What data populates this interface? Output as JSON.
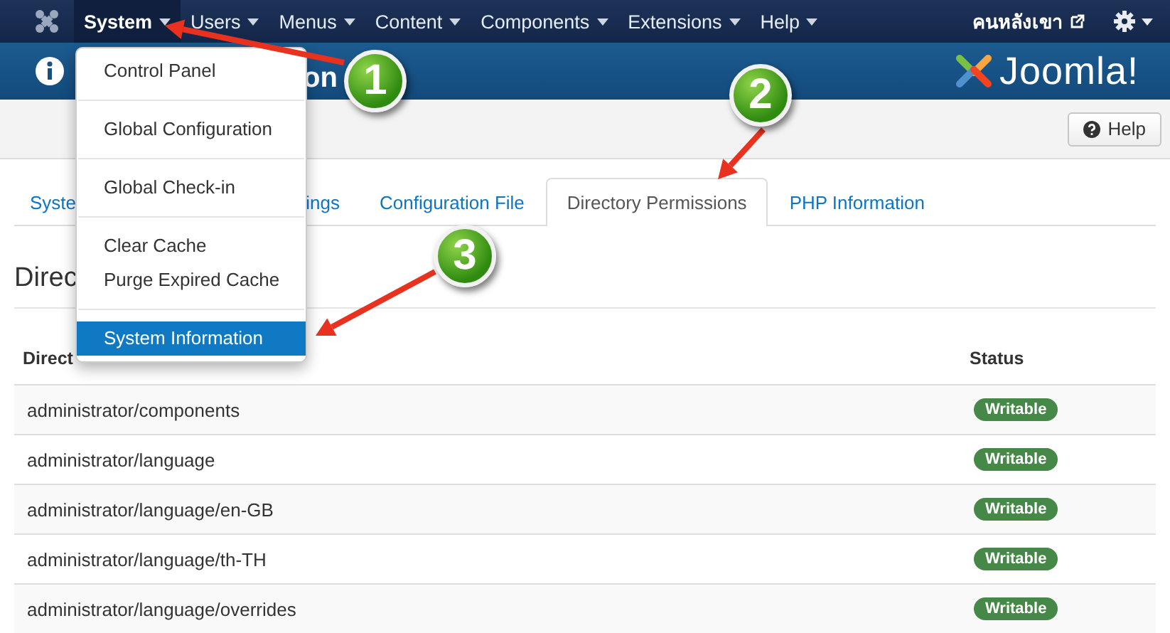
{
  "navbar": {
    "menus": [
      {
        "label": "System",
        "open": true
      },
      {
        "label": "Users",
        "open": false
      },
      {
        "label": "Menus",
        "open": false
      },
      {
        "label": "Content",
        "open": false
      },
      {
        "label": "Components",
        "open": false
      },
      {
        "label": "Extensions",
        "open": false
      },
      {
        "label": "Help",
        "open": false
      }
    ],
    "user": "คนหลังเขา"
  },
  "header": {
    "title": "on",
    "brand": "Joomla!"
  },
  "toolbar": {
    "buttons": [
      {
        "label": "Help"
      }
    ]
  },
  "tabs": [
    {
      "label": "Syste",
      "selected": false
    },
    {
      "label": "ings",
      "selected": false
    },
    {
      "label": "Configuration File",
      "selected": false
    },
    {
      "label": "Directory Permissions",
      "selected": true
    },
    {
      "label": "PHP Information",
      "selected": false
    }
  ],
  "section": {
    "heading": "Direc"
  },
  "table": {
    "columns": [
      "Direct",
      "Status"
    ],
    "rows": [
      {
        "directory": "administrator/components",
        "status": "Writable"
      },
      {
        "directory": "administrator/language",
        "status": "Writable"
      },
      {
        "directory": "administrator/language/en-GB",
        "status": "Writable"
      },
      {
        "directory": "administrator/language/th-TH",
        "status": "Writable"
      },
      {
        "directory": "administrator/language/overrides",
        "status": "Writable"
      }
    ]
  },
  "dropdown": {
    "groups": [
      [
        {
          "label": "Control Panel",
          "selected": false
        }
      ],
      [
        {
          "label": "Global Configuration",
          "selected": false
        }
      ],
      [
        {
          "label": "Global Check-in",
          "selected": false
        }
      ],
      [
        {
          "label": "Clear Cache",
          "selected": false
        },
        {
          "label": "Purge Expired Cache",
          "selected": false
        }
      ],
      [
        {
          "label": "System Information",
          "selected": true
        }
      ]
    ]
  },
  "callouts": [
    {
      "number": "1"
    },
    {
      "number": "2"
    },
    {
      "number": "3"
    }
  ]
}
